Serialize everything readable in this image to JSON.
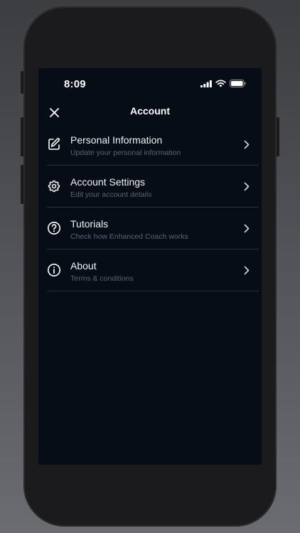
{
  "status_bar": {
    "time": "8:09"
  },
  "header": {
    "title": "Account"
  },
  "menu": {
    "items": [
      {
        "title": "Personal Information",
        "subtitle": "Update your personal information",
        "icon": "edit-icon"
      },
      {
        "title": "Account Settings",
        "subtitle": "Edit your account details",
        "icon": "gear-icon"
      },
      {
        "title": "Tutorials",
        "subtitle": "Check how Enhanced Coach works",
        "icon": "question-circle-icon"
      },
      {
        "title": "About",
        "subtitle": "Terms & conditions",
        "icon": "info-circle-icon"
      }
    ]
  },
  "colors": {
    "screen_background": "#060d17",
    "divider": "#2b313c",
    "text_primary": "#f2f3f5",
    "text_secondary": "#5b6470"
  }
}
